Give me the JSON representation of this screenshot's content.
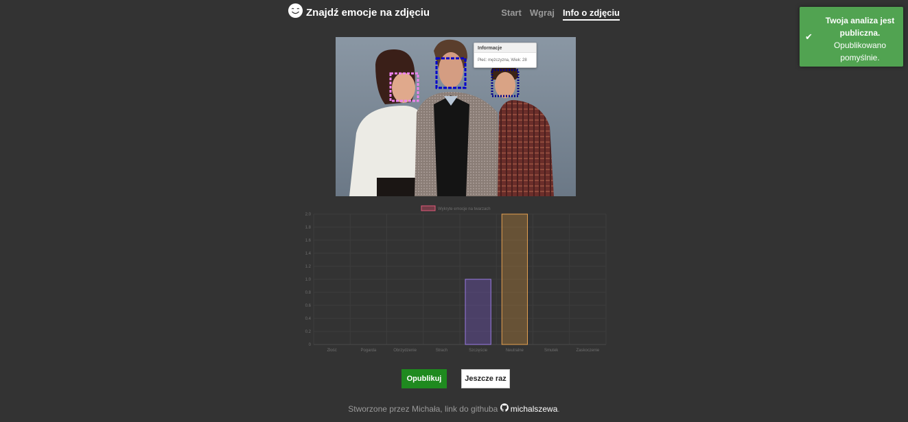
{
  "header": {
    "title": "Znajdź emocje na zdjęciu",
    "logo_icon": "smiley-icon",
    "nav": [
      {
        "label": "Start",
        "active": false
      },
      {
        "label": "Wgraj",
        "active": false
      },
      {
        "label": "Info o zdjęciu",
        "active": true
      }
    ]
  },
  "photo": {
    "tooltip_title": "Informacje",
    "tooltip_body": "Płeć: mężczyzna, Wiek: 28"
  },
  "chart_data": {
    "type": "bar",
    "title": "",
    "legend": "Wykryte emocje na twarzach",
    "legend_position": "top",
    "categories": [
      "Złość",
      "Pogarda",
      "Obrzydzenie",
      "Strach",
      "Szczęście",
      "Neutralne",
      "Smutek",
      "Zaskoczenie"
    ],
    "values": [
      0,
      0,
      0,
      0,
      1,
      2,
      0,
      0
    ],
    "bar_colors": [
      "#c0392b",
      "#c0392b",
      "#c0392b",
      "#c0392b",
      "#9b7be6",
      "#e7a150",
      "#c0392b",
      "#c0392b"
    ],
    "ylim": [
      0,
      2
    ],
    "yticks": [
      "0",
      "0.2",
      "0.4",
      "0.6",
      "0.8",
      "1.0",
      "1.2",
      "1.4",
      "1.6",
      "1.8",
      "2.0"
    ],
    "grid": true
  },
  "actions": {
    "publish_label": "Opublikuj",
    "again_label": "Jeszcze raz"
  },
  "footer": {
    "text": "Stworzone przez Michała, link do githuba",
    "github_user": "michalszewa",
    "end": "."
  },
  "toast": {
    "title": "Twoja analiza jest publiczna.",
    "message": "Opublikowano pomyślnie.",
    "icon": "check-icon"
  },
  "colors": {
    "background": "#333333",
    "publish": "#1f8a1f",
    "toast": "#51a351",
    "face_woman": "#ee82ee",
    "face_man1": "#0000cc",
    "face_man2": "#00008b"
  }
}
